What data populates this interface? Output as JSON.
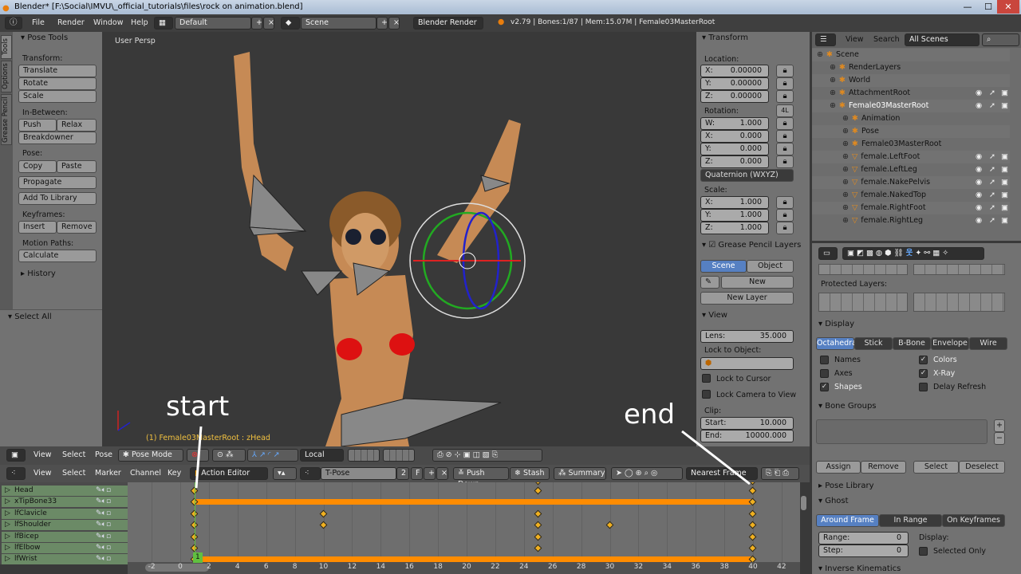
{
  "window": {
    "title": "Blender* [F:\\Social\\IMVU\\_official_tutorials\\files\\rock on animation.blend]",
    "min": "—",
    "max": "☐",
    "close": "✕"
  },
  "topbar": {
    "menus": [
      "File",
      "Render",
      "Window",
      "Help"
    ],
    "layout": "Default",
    "scene": "Scene",
    "engine": "Blender Render",
    "stats": "v2.79 | Bones:1/87 | Mem:15.07M | Female03MasterRoot"
  },
  "tools": {
    "tabs": [
      "Tools",
      "Options",
      "Grease Pencil"
    ],
    "panel_title": "Pose Tools",
    "transform_label": "Transform:",
    "translate": "Translate",
    "rotate": "Rotate",
    "scale": "Scale",
    "inbetween_label": "In-Between:",
    "push": "Push",
    "relax": "Relax",
    "breakdowner": "Breakdowner",
    "pose_label": "Pose:",
    "copy": "Copy",
    "paste": "Paste",
    "propagate": "Propagate",
    "add_to_library": "Add To Library",
    "keyframes_label": "Keyframes:",
    "insert": "Insert",
    "remove": "Remove",
    "motion_paths_label": "Motion Paths:",
    "calculate": "Calculate",
    "history": "History",
    "select_all": "Select All"
  },
  "viewport": {
    "view_name": "User Persp",
    "status": "(1) Female03MasterRoot : zHead"
  },
  "annotations": {
    "start": "start",
    "end": "end"
  },
  "npanel": {
    "transform": "Transform",
    "location": "Location:",
    "loc": [
      {
        "axis": "X:",
        "value": "0.00000"
      },
      {
        "axis": "Y:",
        "value": "0.00000"
      },
      {
        "axis": "Z:",
        "value": "0.00000"
      }
    ],
    "rotation": "Rotation:",
    "rot_badge": "4L",
    "rot": [
      {
        "axis": "W:",
        "value": "1.000"
      },
      {
        "axis": "X:",
        "value": "0.000"
      },
      {
        "axis": "Y:",
        "value": "0.000"
      },
      {
        "axis": "Z:",
        "value": "0.000"
      }
    ],
    "rot_mode": "Quaternion (WXYZ)",
    "scale": "Scale:",
    "scl": [
      {
        "axis": "X:",
        "value": "1.000"
      },
      {
        "axis": "Y:",
        "value": "1.000"
      },
      {
        "axis": "Z:",
        "value": "1.000"
      }
    ],
    "gp_layers": "Grease Pencil Layers",
    "gp_scene": "Scene",
    "gp_object": "Object",
    "gp_new": "New",
    "gp_new_layer": "New Layer",
    "view": "View",
    "lens_label": "Lens:",
    "lens": "35.000",
    "lock_object": "Lock to Object:",
    "lock_cursor": "Lock to Cursor",
    "lock_camera": "Lock Camera to View",
    "clip": "Clip:",
    "clip_start_label": "Start:",
    "clip_start": "10.000",
    "clip_end_label": "End:",
    "clip_end": "10000.000"
  },
  "outliner": {
    "view": "View",
    "search": "Search",
    "filter": "All Scenes",
    "rows": [
      {
        "label": "Scene",
        "indent": 0,
        "eye": false
      },
      {
        "label": "RenderLayers",
        "indent": 1,
        "eye": false
      },
      {
        "label": "World",
        "indent": 1,
        "eye": false
      },
      {
        "label": "AttachmentRoot",
        "indent": 1,
        "eye": true
      },
      {
        "label": "Female03MasterRoot",
        "indent": 1,
        "eye": true
      },
      {
        "label": "Animation",
        "indent": 2,
        "eye": false
      },
      {
        "label": "Pose",
        "indent": 2,
        "eye": false
      },
      {
        "label": "Female03MasterRoot",
        "indent": 2,
        "eye": false
      },
      {
        "label": "female.LeftFoot",
        "indent": 2,
        "eye": true
      },
      {
        "label": "female.LeftLeg",
        "indent": 2,
        "eye": true
      },
      {
        "label": "female.NakePelvis",
        "indent": 2,
        "eye": true
      },
      {
        "label": "female.NakedTop",
        "indent": 2,
        "eye": true
      },
      {
        "label": "female.RightFoot",
        "indent": 2,
        "eye": true
      },
      {
        "label": "female.RightLeg",
        "indent": 2,
        "eye": true
      }
    ]
  },
  "properties": {
    "protected_layers": "Protected Layers:",
    "display": "Display",
    "display_modes": [
      "Octahedral",
      "Stick",
      "B-Bone",
      "Envelope",
      "Wire"
    ],
    "checks": [
      {
        "label": "Names",
        "checked": false
      },
      {
        "label": "Colors",
        "checked": true
      },
      {
        "label": "Axes",
        "checked": false
      },
      {
        "label": "X-Ray",
        "checked": true
      },
      {
        "label": "Shapes",
        "checked": true
      },
      {
        "label": "Delay Refresh",
        "checked": false
      }
    ],
    "bone_groups": "Bone Groups",
    "assign": "Assign",
    "remove": "Remove",
    "select": "Select",
    "deselect": "Deselect",
    "pose_library": "Pose Library",
    "ghost": "Ghost",
    "ghost_modes": [
      "Around Frame",
      "In Range",
      "On Keyframes"
    ],
    "range_label": "Range:",
    "range": "0",
    "step_label": "Step:",
    "step": "0",
    "display_label": "Display:",
    "selected_only": "Selected Only",
    "ik": "Inverse Kinematics"
  },
  "view3d_header": {
    "menus": [
      "View",
      "Select",
      "Pose"
    ],
    "mode": "Pose Mode",
    "orientation": "Local"
  },
  "dopesheet_header": {
    "menus": [
      "View",
      "Select",
      "Marker",
      "Channel",
      "Key"
    ],
    "editor": "Action Editor",
    "action": "T-Pose",
    "users": "2",
    "fake": "F",
    "push_down": "Push Down",
    "stash": "Stash",
    "summary": "Summary",
    "snap": "Nearest Frame"
  },
  "timeline": {
    "current_frame": "1",
    "ticks": [
      -2,
      0,
      2,
      4,
      6,
      8,
      10,
      12,
      14,
      16,
      18,
      20,
      22,
      24,
      26,
      28,
      30,
      32,
      34,
      36,
      38,
      40,
      42
    ],
    "channels": [
      {
        "name": "Head",
        "keys": [
          1,
          25,
          40
        ],
        "hold": false
      },
      {
        "name": "xTipBone33",
        "keys": [
          1,
          40
        ],
        "hold": true
      },
      {
        "name": "lfClavicle",
        "keys": [
          1,
          10,
          25,
          40
        ],
        "hold": false
      },
      {
        "name": "lfShoulder",
        "keys": [
          1,
          10,
          25,
          30,
          40
        ],
        "hold": false
      },
      {
        "name": "lfBicep",
        "keys": [
          1,
          25,
          40
        ],
        "hold": false
      },
      {
        "name": "lfElbow",
        "keys": [
          1,
          25,
          40
        ],
        "hold": false
      },
      {
        "name": "lfWrist",
        "keys": [
          1,
          40
        ],
        "hold": true
      }
    ]
  },
  "colors": {
    "keyframe": "#f0b020",
    "hold_bar": "#ff8c00",
    "active": "#5680c2",
    "playhead": "#60c040"
  }
}
